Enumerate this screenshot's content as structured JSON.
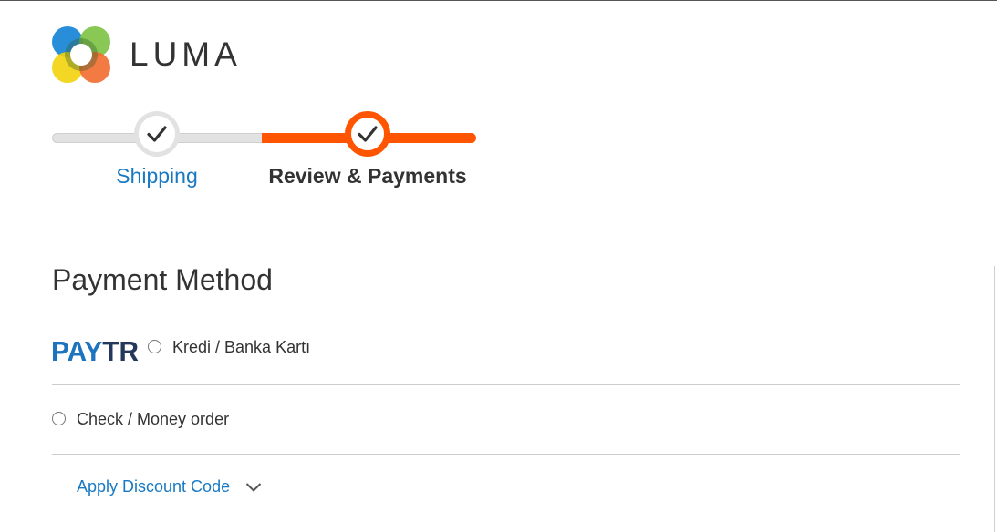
{
  "brand": {
    "name": "LUMA"
  },
  "progress": {
    "steps": [
      {
        "label": "Shipping",
        "state": "complete"
      },
      {
        "label": "Review & Payments",
        "state": "active"
      }
    ],
    "accent_color": "#ff5501",
    "inactive_color": "#e2e2e2"
  },
  "payment": {
    "title": "Payment Method",
    "options": [
      {
        "logo": "PAYTR",
        "label": "Kredi / Banka Kartı",
        "selected": false
      },
      {
        "label": "Check / Money order",
        "selected": false
      }
    ]
  },
  "discount": {
    "label": "Apply Discount Code",
    "icon": "chevron-down-icon"
  },
  "colors": {
    "link": "#1979c3",
    "paytr": "#1e73be",
    "text": "#333333"
  }
}
